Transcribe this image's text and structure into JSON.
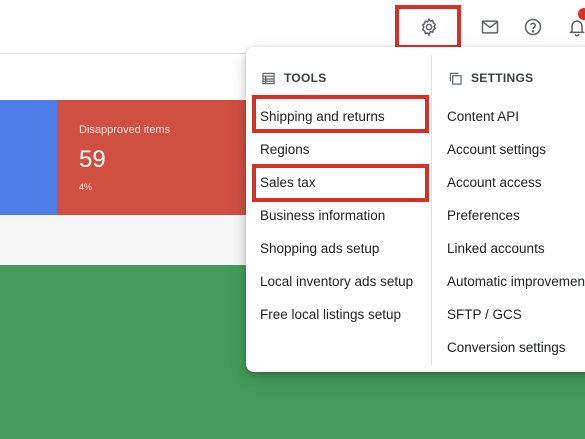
{
  "cards": {
    "disapproved": {
      "label": "Disapproved items",
      "value": "59",
      "percent": "4%"
    }
  },
  "menu": {
    "tools": {
      "heading": "TOOLS",
      "icon": "tools-list-icon",
      "items": [
        "Shipping and returns",
        "Regions",
        "Sales tax",
        "Business information",
        "Shopping ads setup",
        "Local inventory ads setup",
        "Free local listings setup"
      ]
    },
    "settings": {
      "heading": "SETTINGS",
      "icon": "settings-copy-icon",
      "items": [
        "Content API",
        "Account settings",
        "Account access",
        "Preferences",
        "Linked accounts",
        "Automatic improvements",
        "SFTP / GCS",
        "Conversion settings"
      ]
    }
  },
  "icons": [
    "gear-icon",
    "mail-icon",
    "help-icon",
    "bell-icon"
  ],
  "colors": {
    "highlight": "#d93025",
    "card_blue": "#4d7de8",
    "card_red": "#cf4f41",
    "green": "#439b5a"
  }
}
